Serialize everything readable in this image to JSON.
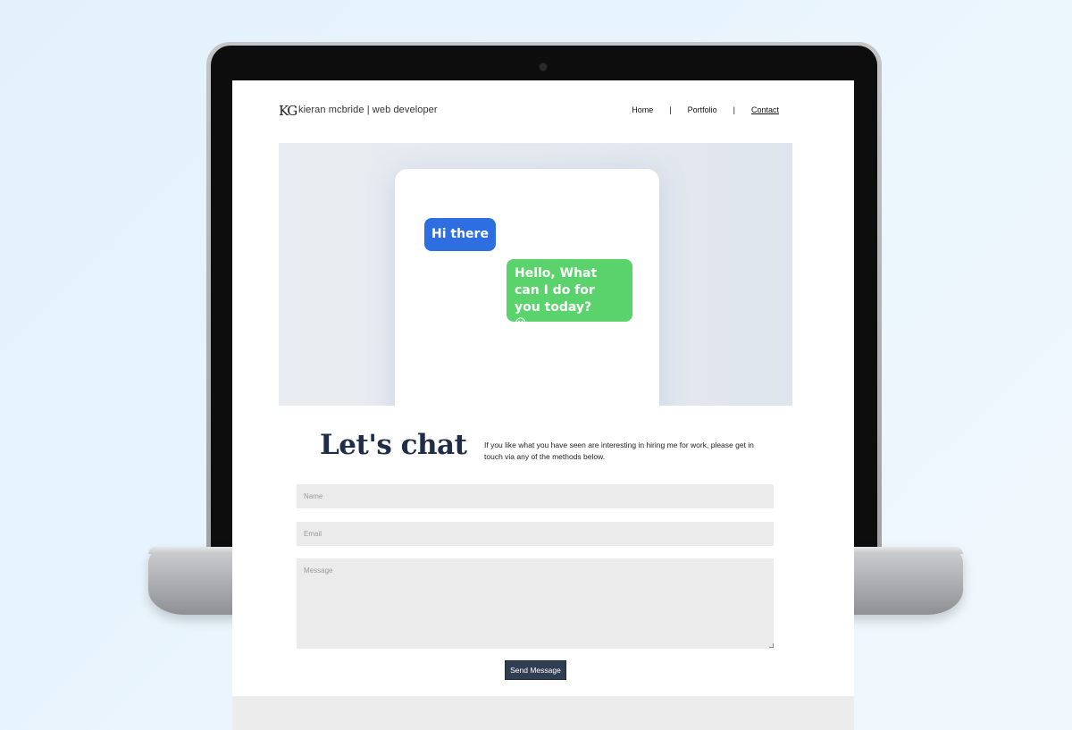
{
  "header": {
    "logo_mark": "KG",
    "brand": "kieran mcbride | web developer",
    "nav": [
      {
        "label": "Home"
      },
      {
        "label": "Portfolio"
      },
      {
        "label": "Contact"
      }
    ],
    "separator": "|"
  },
  "hero": {
    "bubble_left": "Hi there",
    "bubble_right": "Hello, What can I do for you today?",
    "bubble_right_emoji": "☺",
    "colors": {
      "blue_bubble": "#2d6fe0",
      "green_bubble": "#5ad36c"
    }
  },
  "contact": {
    "title": "Let's chat",
    "intro": "If you like what you have seen are interesting in hiring me for work, please get in touch via any of the methods below.",
    "name_placeholder": "Name",
    "email_placeholder": "Email",
    "message_placeholder": "Message",
    "send_label": "Send Message",
    "button_color": "#2f3e52"
  }
}
